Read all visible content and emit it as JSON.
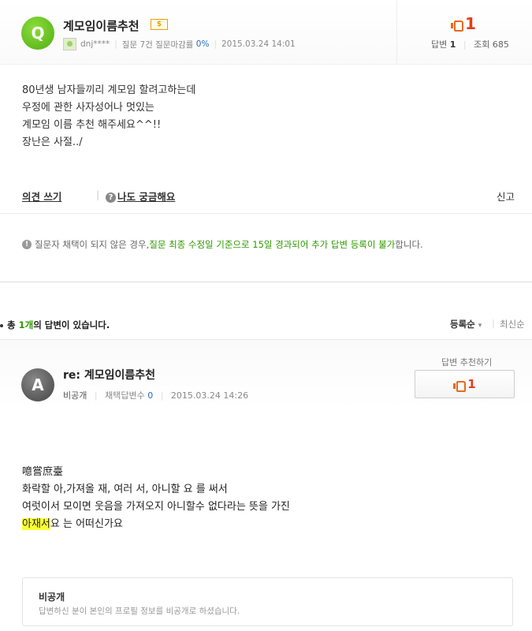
{
  "question": {
    "badge": "Q",
    "title": "계모임이름추천",
    "bounty_badge": "$",
    "author": "dnj****",
    "stats_prefix": "질문 7건 질문마감률",
    "close_rate": "0%",
    "date": "2015.03.24 14:01",
    "votes": "1",
    "answers_label": "답변",
    "answers_count": "1",
    "views_label": "조회",
    "views_count": "685",
    "body": [
      "80년생 남자들끼리 계모임 할려고하는데",
      "우정에 관한 사자성어나 멋있는",
      "계모임 이름 추천 해주세요^^!!",
      "장난은 사절../"
    ],
    "comment_link": "의견 쓰기",
    "sep": "|",
    "curious_icon": "?",
    "curious_link": "나도 궁금해요",
    "report_link": "신고"
  },
  "notice": {
    "icon": "!",
    "prefix": "질문자 채택이 되지 않은 경우, ",
    "highlight": "질문 최종 수정일 기준으로 15일 경과되어 추가 답변 등록이 불가",
    "suffix": "합니다."
  },
  "answers_bar": {
    "prefix": "총 ",
    "count": "1개",
    "suffix": "의 답변이 있습니다.",
    "sort_selected": "등록순",
    "sort_arrow": "▾",
    "sort_sep": "|",
    "sort_other": "최신순"
  },
  "answer": {
    "badge": "A",
    "title": "re: 계모임이름추천",
    "author": "비공개",
    "selected_label": "채택답변수",
    "selected_count": "0",
    "date": "2015.03.24 14:26",
    "recommend_label": "답변 추천하기",
    "recommend_count": "1",
    "body_line1": "噫嘗庶臺",
    "body_line2": "화락할 아,가져올 재, 여러 서, 아니할 요 를 써서",
    "body_line3": "여럿이서 모이면 웃음을 가져오지 아니할수 없다라는 뜻을 가진",
    "body_hl": "아재서",
    "body_line4_rest": "요 는 어떠신가요",
    "private_title": "비공개",
    "private_desc": "답변하신 분이 본인의 프로필 정보를 비공개로 하셨습니다."
  },
  "colors": {
    "q_badge": "#5cbf18",
    "accent_green": "#2f9800",
    "vote_red": "#e53d1a",
    "highlight": "#ffff33"
  }
}
